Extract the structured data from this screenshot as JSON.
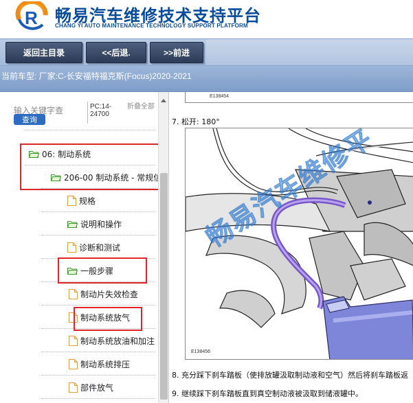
{
  "header": {
    "title": "畅易汽车维修技术支持平台",
    "subtitle": "CHANG YI AUTO MAINTENANCE TECHNOLOGY SUPPORT PLATFORM",
    "logo_icon": "chang-yi-logo",
    "brand_color": "#0a4c9c"
  },
  "toolbar": {
    "back_home_label": "返回主目录",
    "prev_label": "<<后退.",
    "next_label": ">>前进"
  },
  "model_bar": {
    "text": "当前车型:   厂家:C-长安福特福克斯(Focus)2020-2021"
  },
  "search": {
    "placeholder": "输入关键字查",
    "button_label": "查询",
    "pc_label": "PC:14-24700",
    "collapse_label": "折叠全部"
  },
  "tree": {
    "items": [
      {
        "label": "06: 制动系统",
        "icon": "folder-open-icon"
      },
      {
        "label": "206-00 制动系统 - 常规信",
        "icon": "folder-open-icon"
      },
      {
        "label": "规格",
        "icon": "page-icon"
      },
      {
        "label": "说明和操作",
        "icon": "folder-open-icon"
      },
      {
        "label": "诊断和测试",
        "icon": "page-icon"
      },
      {
        "label": "一般步骤",
        "icon": "folder-open-icon"
      },
      {
        "label": "制动片失效检查",
        "icon": "page-icon"
      },
      {
        "label": "制动系统放气",
        "icon": "page-icon"
      },
      {
        "label": "制动系统放油和加注",
        "icon": "page-icon"
      },
      {
        "label": "制动系统排压",
        "icon": "page-icon"
      },
      {
        "label": "部件放气",
        "icon": "page-icon"
      }
    ],
    "highlight_color": "#e0262b"
  },
  "document": {
    "top_figure_code": "E138454",
    "step7": "7. 松开: 180°",
    "figure_code": "E138456",
    "watermark": "畅易汽车维修平",
    "step8": "8. 充分踩下刹车踏板（使排放罐汲取制动液和空气）然后将刹车踏板返",
    "step9": "9. 继续踩下刹车踏板直到真空制动液被汲取到储液罐中。"
  }
}
